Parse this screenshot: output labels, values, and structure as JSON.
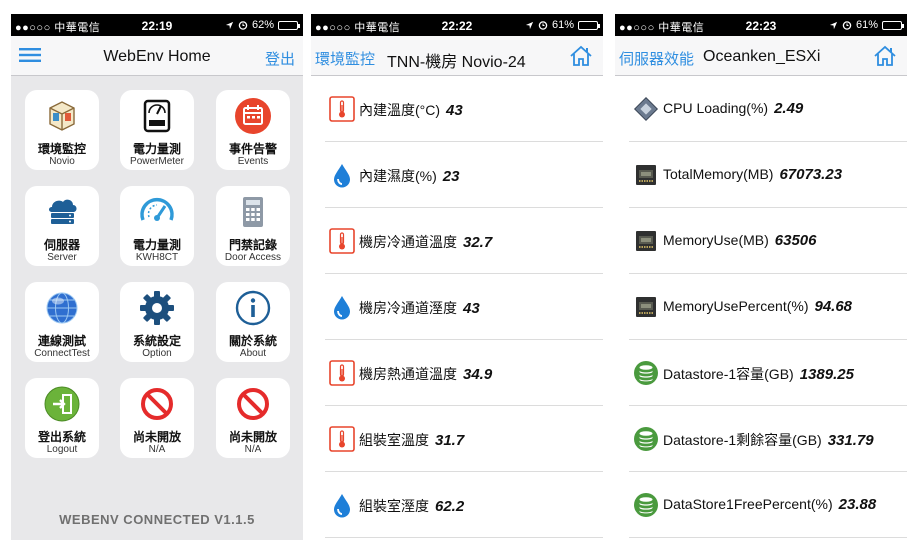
{
  "status": [
    {
      "carrier": "●●○○○ 中華電信",
      "time": "22:19",
      "battery": "62%",
      "battery_level": 0.62
    },
    {
      "carrier": "●●○○○ 中華電信",
      "time": "22:22",
      "battery": "61%",
      "battery_level": 0.61
    },
    {
      "carrier": "●●○○○ 中華電信",
      "time": "22:23",
      "battery": "61%",
      "battery_level": 0.61
    }
  ],
  "home": {
    "title": "WebEnv Home",
    "logout_link": "登出",
    "tiles": [
      {
        "zh": "環境監控",
        "en": "Novio",
        "icon": "cube-icon"
      },
      {
        "zh": "電力量測",
        "en": "PowerMeter",
        "icon": "meter-icon"
      },
      {
        "zh": "事件告警",
        "en": "Events",
        "icon": "calendar-icon"
      },
      {
        "zh": "伺服器",
        "en": "Server",
        "icon": "server-icon"
      },
      {
        "zh": "電力量測",
        "en": "KWH8CT",
        "icon": "gauge-icon"
      },
      {
        "zh": "門禁記錄",
        "en": "Door Access",
        "icon": "keypad-icon"
      },
      {
        "zh": "連線測試",
        "en": "ConnectTest",
        "icon": "globe-icon"
      },
      {
        "zh": "系統設定",
        "en": "Option",
        "icon": "gear-icon"
      },
      {
        "zh": "關於系統",
        "en": "About",
        "icon": "info-icon"
      },
      {
        "zh": "登出系統",
        "en": "Logout",
        "icon": "logout-icon"
      },
      {
        "zh": "尚未開放",
        "en": "N/A",
        "icon": "blocked-icon"
      },
      {
        "zh": "尚未開放",
        "en": "N/A",
        "icon": "blocked-icon"
      }
    ],
    "version": "WEBENV CONNECTED V1.1.5"
  },
  "env": {
    "back": "環境監控",
    "title": "TNN-機房 Novio-24",
    "rows": [
      {
        "label": "內建溫度(°C)",
        "value": "43",
        "icon": "thermometer-icon"
      },
      {
        "label": "內建濕度(%)",
        "value": "23",
        "icon": "water-drop-icon"
      },
      {
        "label": "機房冷通道溫度",
        "value": "32.7",
        "icon": "thermometer-icon"
      },
      {
        "label": "機房冷通道溼度",
        "value": "43",
        "icon": "water-drop-icon"
      },
      {
        "label": "機房熱通道溫度",
        "value": "34.9",
        "icon": "thermometer-icon"
      },
      {
        "label": "組裝室溫度",
        "value": "31.7",
        "icon": "thermometer-icon"
      },
      {
        "label": "組裝室溼度",
        "value": "62.2",
        "icon": "water-drop-icon"
      }
    ]
  },
  "server": {
    "back": "伺服器效能",
    "title": "Oceanken_ESXi",
    "rows": [
      {
        "label": "CPU Loading(%)",
        "value": "2.49",
        "icon": "cpu-icon"
      },
      {
        "label": "TotalMemory(MB)",
        "value": "67073.23",
        "icon": "ram-icon"
      },
      {
        "label": "MemoryUse(MB)",
        "value": "63506",
        "icon": "ram-icon"
      },
      {
        "label": "MemoryUsePercent(%)",
        "value": "94.68",
        "icon": "ram-icon"
      },
      {
        "label": "Datastore-1容量(GB)",
        "value": "1389.25",
        "icon": "database-icon"
      },
      {
        "label": "Datastore-1剩餘容量(GB)",
        "value": "331.79",
        "icon": "database-icon"
      },
      {
        "label": "DataStore1FreePercent(%)",
        "value": "23.88",
        "icon": "database-icon"
      }
    ]
  },
  "colors": {
    "accent": "#2f8ee0",
    "alert_red": "#e8452c",
    "water_blue": "#1e7fd8",
    "db_green": "#4a9a3e"
  }
}
